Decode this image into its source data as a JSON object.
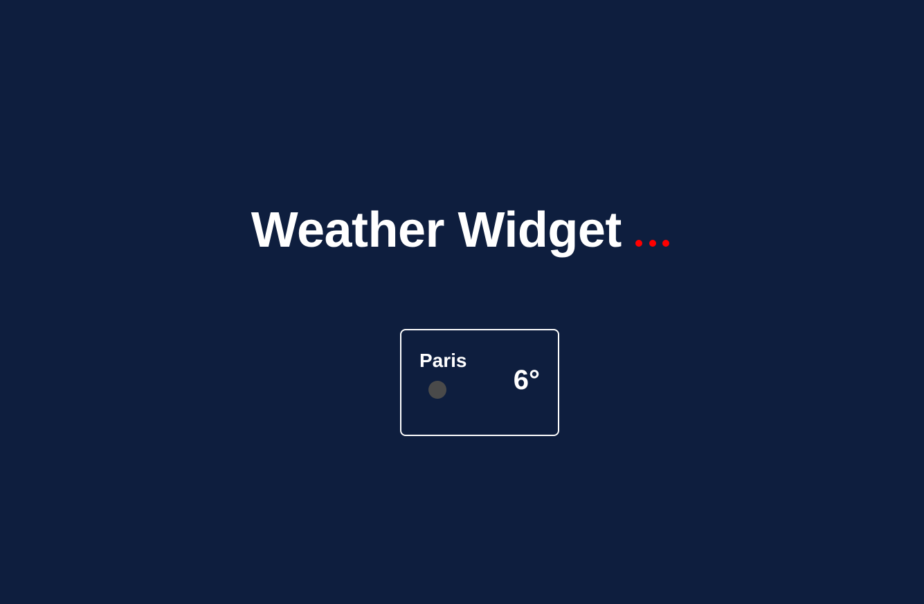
{
  "header": {
    "title": "Weather Widget",
    "loading_icon": "loading-dots-icon",
    "loading_color": "#ff0000",
    "dot_count": 3
  },
  "widget": {
    "city": "Paris",
    "temperature": "6°",
    "weather_icon": "weather-icon",
    "icon_color": "#4a4a4a"
  },
  "colors": {
    "background": "#0e1e3e",
    "text": "#ffffff",
    "card_border": "#ffffff"
  }
}
